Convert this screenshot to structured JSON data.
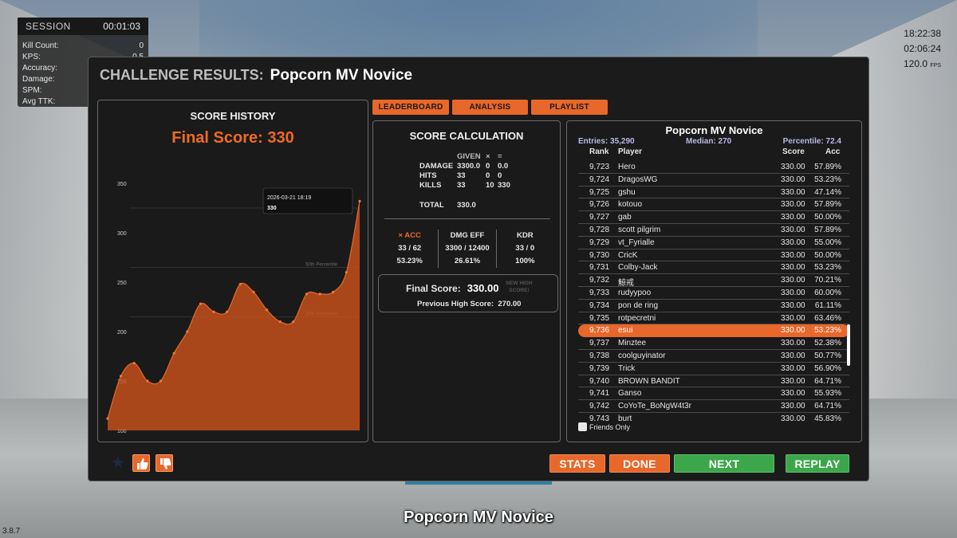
{
  "session": {
    "title": "SESSION",
    "timer": "00:01:03",
    "rows": [
      {
        "label": "Kill Count:",
        "value": "0"
      },
      {
        "label": "KPS:",
        "value": "0.5"
      },
      {
        "label": "Accuracy:",
        "value": "5"
      },
      {
        "label": "Damage:",
        "value": "3,300 / 1"
      },
      {
        "label": "SPM:",
        "value": ""
      },
      {
        "label": "Avg TTK:",
        "value": ""
      }
    ]
  },
  "clock": {
    "time": "18:22:38",
    "elapsed": "02:06:24",
    "fps": "120.0",
    "fps_unit": "FPS"
  },
  "version": "3.8.7",
  "caption": "Popcorn MV Novice",
  "modal": {
    "title_prefix": "CHALLENGE RESULTS:",
    "title_name": "Popcorn MV Novice"
  },
  "history": {
    "header": "SCORE HISTORY",
    "final_score": "Final Score: 330",
    "tooltip_date": "2026-03-21 18:19",
    "tooltip_value": "330",
    "percentile_labels": [
      "75th Percentile",
      "50th Percentile",
      "25th Percentile"
    ]
  },
  "chart_data": {
    "type": "area",
    "title": "SCORE HISTORY",
    "ylim": [
      100,
      350
    ],
    "yticks": [
      "350",
      "300",
      "250",
      "200",
      "150",
      "100"
    ],
    "y_values": [
      112,
      155,
      168,
      150,
      150,
      178,
      200,
      228,
      220,
      220,
      248,
      240,
      222,
      210,
      210,
      238,
      238,
      240,
      260,
      332
    ],
    "percentiles": [
      {
        "name": "75th Percentile",
        "value": 325
      },
      {
        "name": "50th Percentile",
        "value": 265
      },
      {
        "name": "25th Percentile",
        "value": 215
      }
    ],
    "color": "#d2551c"
  },
  "tabs": [
    "LEADERBOARD",
    "ANALYSIS",
    "PLAYLIST"
  ],
  "calc": {
    "header": "SCORE CALCULATION",
    "col_given": "GIVEN",
    "col_mult": "×",
    "col_eq": "=",
    "rows": [
      {
        "label": "DAMAGE",
        "given": "3300.0",
        "mult": "0",
        "result": "0.0"
      },
      {
        "label": "HITS",
        "given": "33",
        "mult": "0",
        "result": "0"
      },
      {
        "label": "KILLS",
        "given": "33",
        "mult": "10",
        "result": "330"
      }
    ],
    "total_label": "TOTAL",
    "total_value": "330.0",
    "stats": [
      {
        "label": "× ACC",
        "ratio": "33 / 62",
        "pct": "53.23%"
      },
      {
        "label": "DMG EFF",
        "ratio": "3300 / 12400",
        "pct": "26.61%"
      },
      {
        "label": "KDR",
        "ratio": "33 / 0",
        "pct": "100%"
      }
    ],
    "final_label": "Final Score:",
    "final_value": "330.00",
    "new_high": "NEW HIGH SCORE!",
    "prev_label": "Previous High Score:",
    "prev_value": "270.00"
  },
  "leaderboard": {
    "title": "Popcorn MV Novice",
    "entries": "Entries: 35,290",
    "median": "Median: 270",
    "percentile": "Percentile: 72.4",
    "col_rank": "Rank",
    "col_player": "Player",
    "col_score": "Score",
    "col_acc": "Acc",
    "rows": [
      {
        "rank": "9,723",
        "player": "Hero",
        "score": "330.00",
        "acc": "57.89%"
      },
      {
        "rank": "9,724",
        "player": "DragosWG",
        "score": "330.00",
        "acc": "53.23%"
      },
      {
        "rank": "9,725",
        "player": "gshu",
        "score": "330.00",
        "acc": "47.14%"
      },
      {
        "rank": "9,726",
        "player": "kotouo",
        "score": "330.00",
        "acc": "57.89%"
      },
      {
        "rank": "9,727",
        "player": "gab",
        "score": "330.00",
        "acc": "50.00%"
      },
      {
        "rank": "9,728",
        "player": "scott pilgrim",
        "score": "330.00",
        "acc": "57.89%"
      },
      {
        "rank": "9,729",
        "player": "vt_Fyrialle",
        "score": "330.00",
        "acc": "55.00%"
      },
      {
        "rank": "9,730",
        "player": "CricK",
        "score": "330.00",
        "acc": "50.00%"
      },
      {
        "rank": "9,731",
        "player": "Colby-Jack",
        "score": "330.00",
        "acc": "53.23%"
      },
      {
        "rank": "9,732",
        "player": "鯨戒",
        "score": "330.00",
        "acc": "70.21%"
      },
      {
        "rank": "9,733",
        "player": "rudyypoo",
        "score": "330.00",
        "acc": "60.00%"
      },
      {
        "rank": "9,734",
        "player": "pon de ring",
        "score": "330.00",
        "acc": "61.11%"
      },
      {
        "rank": "9,735",
        "player": "rotpecretni",
        "score": "330.00",
        "acc": "63.46%"
      },
      {
        "rank": "9,736",
        "player": "esui",
        "score": "330.00",
        "acc": "53.23%",
        "me": true
      },
      {
        "rank": "9,737",
        "player": "Minztee",
        "score": "330.00",
        "acc": "52.38%"
      },
      {
        "rank": "9,738",
        "player": "coolguyinator",
        "score": "330.00",
        "acc": "50.77%"
      },
      {
        "rank": "9,739",
        "player": "Trick",
        "score": "330.00",
        "acc": "56.90%"
      },
      {
        "rank": "9,740",
        "player": "BROWN BANDIT",
        "score": "330.00",
        "acc": "64.71%"
      },
      {
        "rank": "9,741",
        "player": "Ganso",
        "score": "330.00",
        "acc": "55.93%"
      },
      {
        "rank": "9,742",
        "player": "CoYoTe_BoNgW4t3r",
        "score": "330.00",
        "acc": "64.71%"
      },
      {
        "rank": "9,743",
        "player": "burt",
        "score": "330.00",
        "acc": "45.83%"
      }
    ],
    "friends_only": "Friends Only"
  },
  "buttons": {
    "stats": "STATS",
    "done": "DONE",
    "next": "NEXT",
    "replay": "REPLAY"
  }
}
